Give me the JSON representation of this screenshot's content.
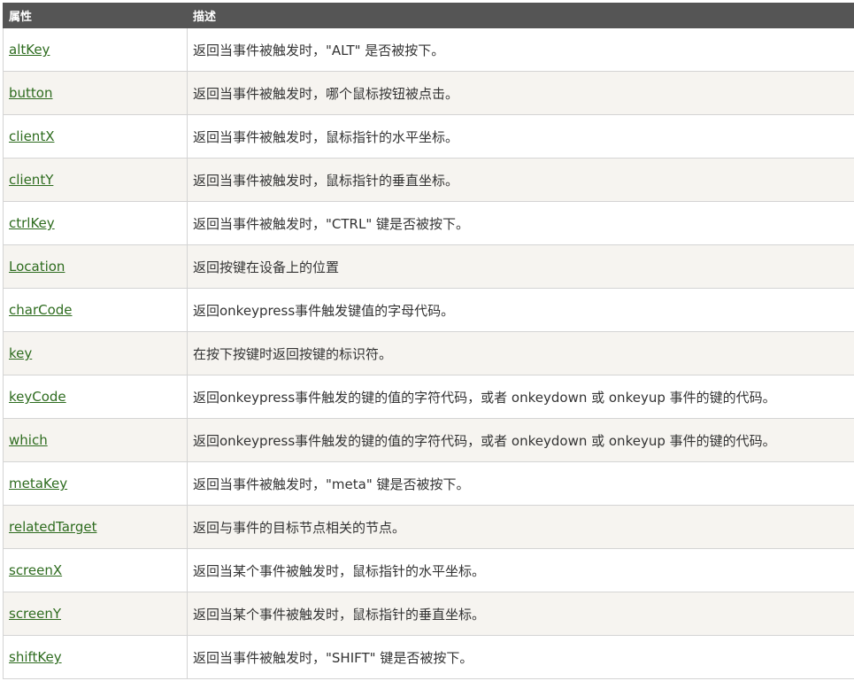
{
  "table": {
    "headers": [
      "属性",
      "描述"
    ],
    "rows": [
      {
        "property": "altKey",
        "description": "返回当事件被触发时，\"ALT\" 是否被按下。"
      },
      {
        "property": "button",
        "description": "返回当事件被触发时，哪个鼠标按钮被点击。"
      },
      {
        "property": "clientX",
        "description": "返回当事件被触发时，鼠标指针的水平坐标。"
      },
      {
        "property": "clientY",
        "description": "返回当事件被触发时，鼠标指针的垂直坐标。"
      },
      {
        "property": "ctrlKey",
        "description": "返回当事件被触发时，\"CTRL\" 键是否被按下。"
      },
      {
        "property": "Location",
        "description": "返回按键在设备上的位置"
      },
      {
        "property": "charCode",
        "description": "返回onkeypress事件触发键值的字母代码。"
      },
      {
        "property": "key",
        "description": "在按下按键时返回按键的标识符。"
      },
      {
        "property": "keyCode",
        "description": "返回onkeypress事件触发的键的值的字符代码，或者 onkeydown 或 onkeyup 事件的键的代码。"
      },
      {
        "property": "which",
        "description": "返回onkeypress事件触发的键的值的字符代码，或者 onkeydown 或 onkeyup 事件的键的代码。"
      },
      {
        "property": "metaKey",
        "description": "返回当事件被触发时，\"meta\" 键是否被按下。"
      },
      {
        "property": "relatedTarget",
        "description": "返回与事件的目标节点相关的节点。"
      },
      {
        "property": "screenX",
        "description": "返回当某个事件被触发时，鼠标指针的水平坐标。"
      },
      {
        "property": "screenY",
        "description": "返回当某个事件被触发时，鼠标指针的垂直坐标。"
      },
      {
        "property": "shiftKey",
        "description": "返回当事件被触发时，\"SHIFT\" 键是否被按下。"
      }
    ]
  },
  "colors": {
    "header_bg": "#555555",
    "header_text": "#ffffff",
    "link": "#2e6c1f",
    "row_alt_bg": "#f6f4f0",
    "border": "#d4d4d4"
  }
}
